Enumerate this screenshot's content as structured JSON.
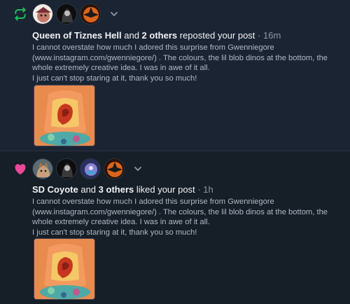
{
  "notifications": [
    {
      "kind": "repost",
      "icon": "repost-icon",
      "actor": "Queen of Tiznes Hell",
      "joiner": " and ",
      "others": "2 others",
      "action": " reposted your post",
      "time": "· 16m",
      "body_lines": [
        "I cannot overstate how much I adored this surprise from Gwenniegore",
        "(www.instagram.com/gwenniegore/) . The colours, the lil blob dinos at the bottom, the",
        "whole extremely creative idea. I was in awe of it all.",
        "I just can't stop staring at it, thank you so much!"
      ],
      "accent": "#20bc5c"
    },
    {
      "kind": "like",
      "icon": "heart-icon",
      "actor": "SD Coyote",
      "joiner": " and ",
      "others": "3 others",
      "action": " liked your post",
      "time": "· 1h",
      "body_lines": [
        "I cannot overstate how much I adored this surprise from Gwenniegore",
        "(www.instagram.com/gwenniegore/) . The colours, the lil blob dinos at the bottom, the",
        "whole extremely creative idea. I was in awe of it all.",
        "I just can't stop staring at it, thank you so much!"
      ],
      "accent": "#ec4899"
    }
  ]
}
